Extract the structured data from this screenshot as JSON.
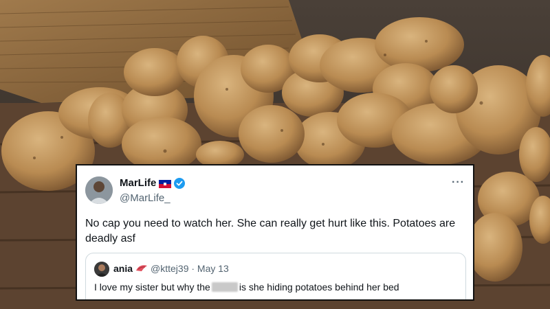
{
  "tweet": {
    "display_name": "MarLife",
    "handle": "@MarLife_",
    "text": "No cap you need to watch her. She can really get hurt like this. Potatoes are deadly asf",
    "more_label": "···"
  },
  "quote": {
    "display_name": "ania",
    "handle_date": "@kttej39 · May 13",
    "text_before": "I love my sister but why the",
    "text_after": "is she hiding potatoes behind her bed"
  },
  "colors": {
    "verified": "#1d9bf0",
    "text": "#0f1419",
    "muted": "#536471"
  }
}
